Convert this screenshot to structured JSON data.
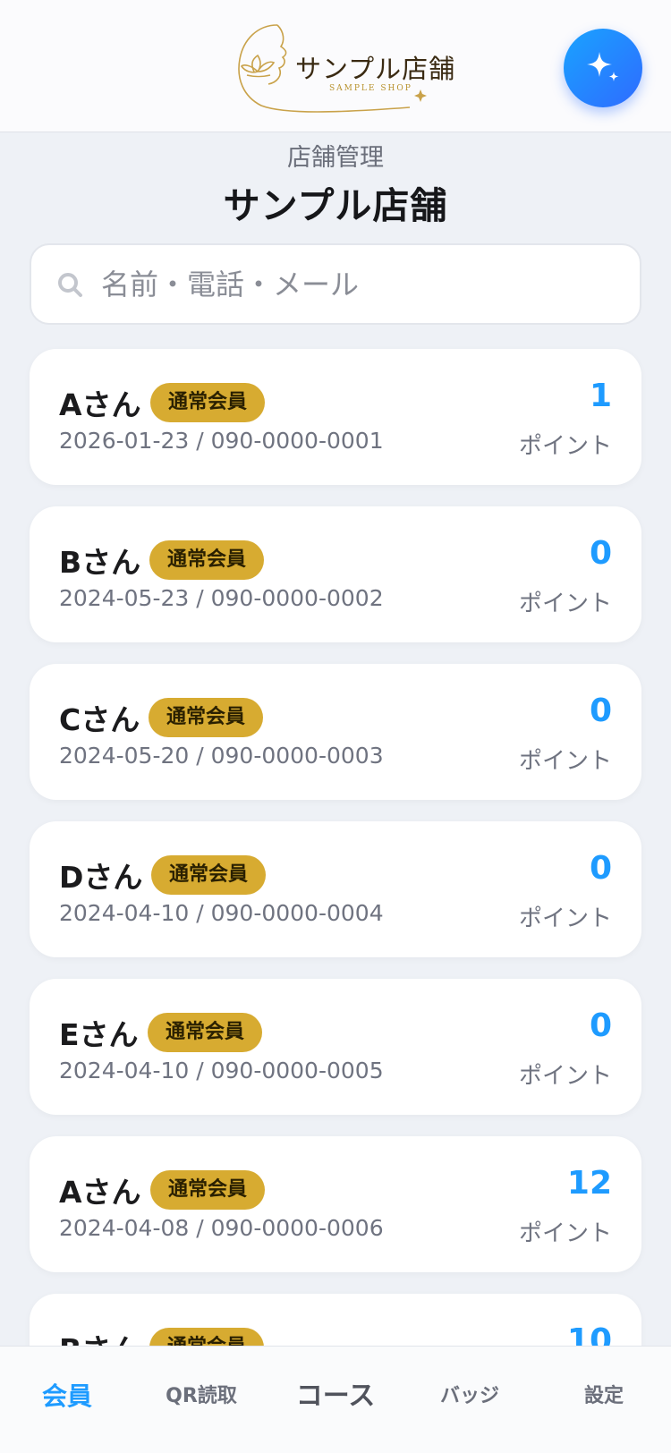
{
  "header": {
    "logo_title": "サンプル店舗",
    "logo_subtitle": "SAMPLE SHOP",
    "accent_color": "#1e9bff"
  },
  "page": {
    "subtitle": "店舗管理",
    "title": "サンプル店舗"
  },
  "search": {
    "placeholder": "名前・電話・メール",
    "value": ""
  },
  "members": [
    {
      "name": "Aさん",
      "badge": "通常会員",
      "meta": "2026-01-23 / 090-0000-0001",
      "points": "1",
      "points_label": "ポイント"
    },
    {
      "name": "Bさん",
      "badge": "通常会員",
      "meta": "2024-05-23 / 090-0000-0002",
      "points": "0",
      "points_label": "ポイント"
    },
    {
      "name": "Cさん",
      "badge": "通常会員",
      "meta": "2024-05-20 / 090-0000-0003",
      "points": "0",
      "points_label": "ポイント"
    },
    {
      "name": "Dさん",
      "badge": "通常会員",
      "meta": "2024-04-10 / 090-0000-0004",
      "points": "0",
      "points_label": "ポイント"
    },
    {
      "name": "Eさん",
      "badge": "通常会員",
      "meta": "2024-04-10 / 090-0000-0005",
      "points": "0",
      "points_label": "ポイント"
    },
    {
      "name": "Aさん",
      "badge": "通常会員",
      "meta": "2024-04-08 / 090-0000-0006",
      "points": "12",
      "points_label": "ポイント"
    },
    {
      "name": "Bさん",
      "badge": "通常会員",
      "meta": "",
      "points": "10",
      "points_label": ""
    }
  ],
  "nav": {
    "members": "会員",
    "qr": "QR読取",
    "course": "コース",
    "badge": "バッジ",
    "settings": "設定"
  }
}
